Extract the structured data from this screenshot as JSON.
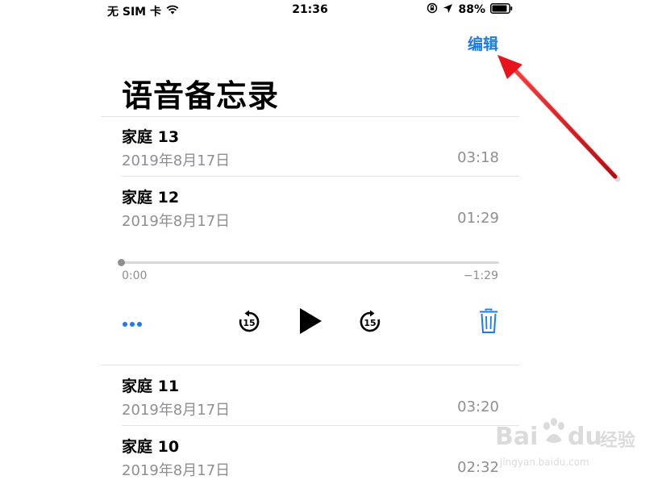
{
  "status": {
    "carrier": "无 SIM 卡",
    "time": "21:36",
    "battery": "88%",
    "battery_level": 0.88,
    "icons": [
      "wifi-icon",
      "rotation-lock-icon",
      "location-arrow-icon",
      "battery-icon"
    ]
  },
  "header": {
    "edit_label": "编辑",
    "title": "语音备忘录"
  },
  "recordings": [
    {
      "name": "家庭 13",
      "date": "2019年8月17日",
      "duration": "03:18"
    },
    {
      "name": "家庭 12",
      "date": "2019年8月17日",
      "duration": "01:29"
    },
    {
      "name": "家庭 11",
      "date": "2019年8月17日",
      "duration": "03:20"
    },
    {
      "name": "家庭 10",
      "date": "2019年8月17日",
      "duration": "02:32"
    }
  ],
  "player": {
    "elapsed": "0:00",
    "remaining": "−1:29",
    "progress": 0.0,
    "skip_back_seconds": "15",
    "skip_forward_seconds": "15",
    "controls": [
      "more-icon",
      "skip-back-15-icon",
      "play-icon",
      "skip-forward-15-icon",
      "trash-icon"
    ]
  },
  "watermark": {
    "brand": "Bai",
    "brand_suffix": "du",
    "product": "经验",
    "url": "jingyan.baidu.com"
  },
  "colors": {
    "accent": "#1a7cf0",
    "secondary_text": "#8e8e93",
    "annotation_arrow": "#e8141b"
  }
}
